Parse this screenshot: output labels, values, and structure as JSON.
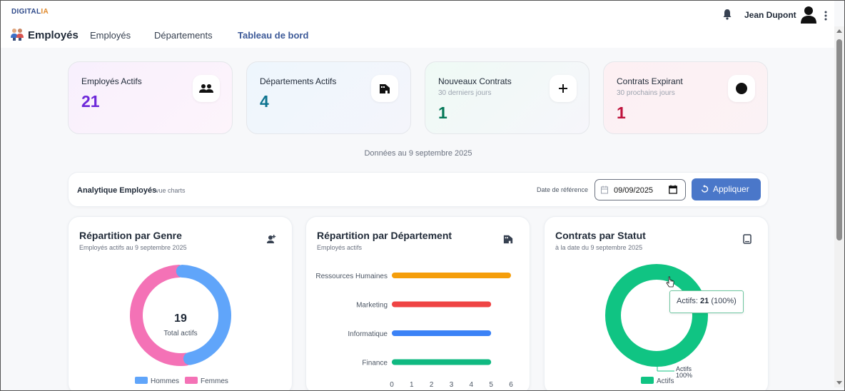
{
  "header": {
    "brand_main": "DIGITAL",
    "brand_accent": "IA",
    "app_title": "Employés",
    "nav": [
      {
        "label": "Employés",
        "active": false
      },
      {
        "label": "Départements",
        "active": false
      },
      {
        "label": "Tableau de bord",
        "active": true
      }
    ],
    "user_name": "Jean Dupont",
    "icons": {
      "notifications": "bell-icon",
      "user": "avatar-icon",
      "menu": "kebab-menu-icon"
    }
  },
  "stats": [
    {
      "label": "Employés Actifs",
      "sub": "",
      "value": "21",
      "color": "#6d28d9",
      "icon": "users-icon"
    },
    {
      "label": "Départements Actifs",
      "sub": "",
      "value": "4",
      "color": "#0e7490",
      "icon": "building-icon"
    },
    {
      "label": "Nouveaux Contrats",
      "sub": "30 derniers jours",
      "value": "1",
      "color": "#047857",
      "icon": "plus-icon"
    },
    {
      "label": "Contrats Expirant",
      "sub": "30 prochains jours",
      "value": "1",
      "color": "#be123c",
      "icon": "dot-icon"
    }
  ],
  "as_of": "Données au 9 septembre 2025",
  "filters": {
    "title": "Analytique Employés",
    "subtitle": "vue charts",
    "date_label": "Date de référence",
    "date_value": "09/09/2025",
    "apply_label": "Appliquer"
  },
  "colors": {
    "accent": "#4a77c9",
    "hommes": "#60a5fa",
    "femmes": "#f472b6",
    "actifs": "#10c483"
  },
  "charts": [
    {
      "title": "Répartition par Genre",
      "subtitle": "Employés actifs au 9 septembre 2025",
      "icon": "user-plus-icon"
    },
    {
      "title": "Répartition par Département",
      "subtitle": "Employés actifs",
      "icon": "building-icon"
    },
    {
      "title": "Contrats par Statut",
      "subtitle": "à la date du 9 septembre 2025",
      "icon": "document-icon"
    }
  ],
  "chart_data": [
    {
      "type": "pie",
      "labels": [
        "Hommes",
        "Femmes"
      ],
      "values": [
        9,
        10
      ],
      "colors": [
        "#60a5fa",
        "#f472b6"
      ],
      "center_value": "19",
      "center_label": "Total actifs",
      "legend": "bottom"
    },
    {
      "type": "bar",
      "orientation": "horizontal",
      "categories": [
        "Ressources Humaines",
        "Marketing",
        "Informatique",
        "Finance"
      ],
      "values": [
        6,
        5,
        5,
        5
      ],
      "colors": [
        "#f59e0b",
        "#ef4444",
        "#3b82f6",
        "#10b981"
      ],
      "xlim": [
        0,
        6
      ],
      "xticks": [
        "0",
        "1",
        "2",
        "3",
        "4",
        "5",
        "6"
      ],
      "grid": false
    },
    {
      "type": "pie",
      "labels": [
        "Actifs"
      ],
      "values": [
        21
      ],
      "colors": [
        "#10c483"
      ],
      "data_label": "Actifs",
      "data_label_pct": "100%",
      "tooltip_label": "Actifs:",
      "tooltip_value": "21",
      "tooltip_pct": "(100%)",
      "legend": "bottom"
    }
  ]
}
